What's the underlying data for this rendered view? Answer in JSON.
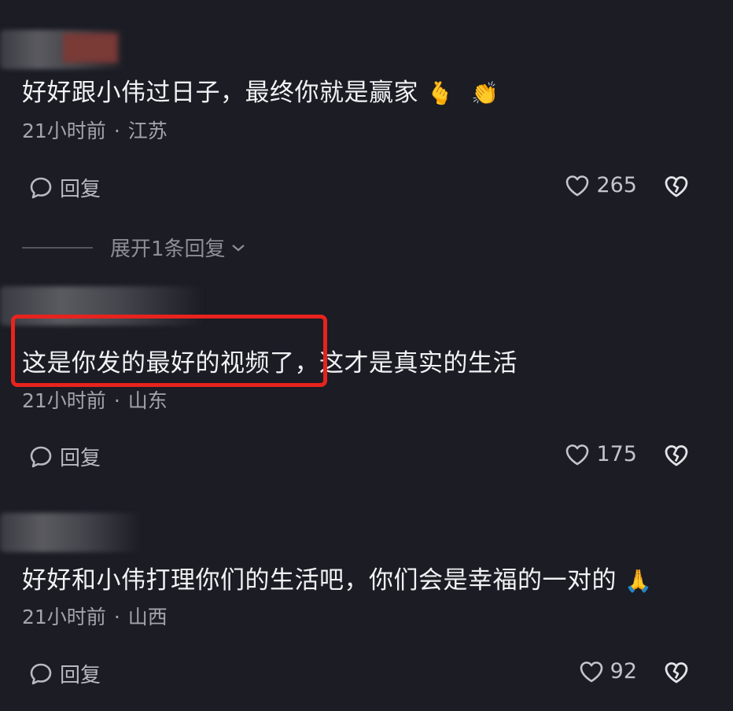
{
  "comments": [
    {
      "text": "好好跟小伟过日子，最终你就是赢家",
      "emojis": [
        "🫰",
        "👏"
      ],
      "time": "21小时前",
      "location": "江苏",
      "reply_label": "回复",
      "likes": "265"
    },
    {
      "text": "这是你发的最好的视频了，这才是真实的生活",
      "time": "21小时前",
      "location": "山东",
      "reply_label": "回复",
      "likes": "175"
    },
    {
      "text": "好好和小伟打理你们的生活吧，你们会是幸福的一对的",
      "emojis": [
        "🙏"
      ],
      "time": "21小时前",
      "location": "山西",
      "reply_label": "回复",
      "likes": "92"
    }
  ],
  "expand_replies_label": "展开1条回复",
  "separator": "·",
  "colors": {
    "highlight_box": "#e8231d",
    "background": "#1b1c24"
  },
  "icons": [
    "speech-bubble-icon",
    "heart-icon",
    "broken-heart-icon",
    "chevron-down-icon"
  ]
}
